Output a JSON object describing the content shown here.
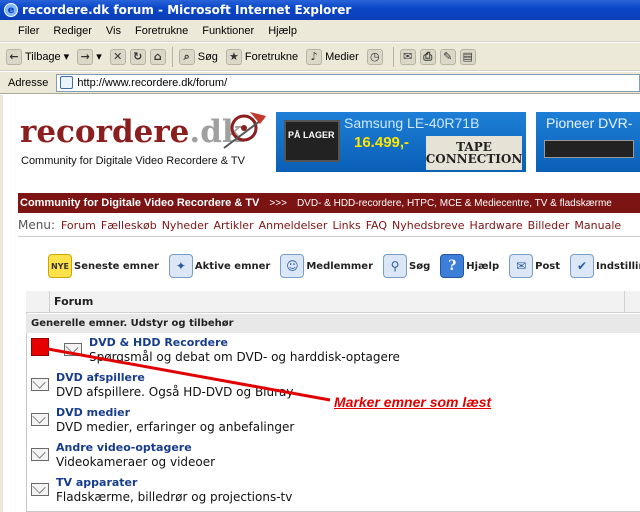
{
  "window": {
    "title": "recordere.dk forum - Microsoft Internet Explorer"
  },
  "menubar": {
    "items": [
      "Filer",
      "Rediger",
      "Vis",
      "Foretrukne",
      "Funktioner",
      "Hjælp"
    ]
  },
  "toolbar": {
    "back": "Tilbage",
    "search": "Søg",
    "favorites": "Foretrukne",
    "media": "Medier"
  },
  "addressbar": {
    "label": "Adresse",
    "url": "http://www.recordere.dk/forum/"
  },
  "site": {
    "logo_main": "recordere",
    "logo_tld": ".dk",
    "tagline": "Community for Digitale Video Recordere & TV",
    "banners": [
      {
        "badge": "PÅ LAGER",
        "title": "Samsung LE-40R71B",
        "price": "16.499,-",
        "brand": "TAPE CONNECTION"
      },
      {
        "title": "Pioneer DVR-"
      }
    ],
    "community_bar": {
      "left": "Community for Digitale Video Recordere & TV",
      "arrow": ">>>",
      "right": "DVD- & HDD-recordere, HTPC, MCE & Mediecentre, TV & fladskærme"
    },
    "site_menu": {
      "label": "Menu:",
      "items": [
        "Forum",
        "Fælleskøb",
        "Nyheder",
        "Artikler",
        "Anmeldelser",
        "Links",
        "FAQ",
        "Nyhedsbreve",
        "Hardware",
        "Billeder",
        "Manuale"
      ]
    },
    "nav_icons": [
      {
        "icon": "new-badge-icon",
        "badge": "NYE",
        "label": "Seneste emner"
      },
      {
        "icon": "sparkle-icon",
        "label": "Aktive emner"
      },
      {
        "icon": "members-icon",
        "label": "Medlemmer"
      },
      {
        "icon": "magnifier-icon",
        "label": "Søg"
      },
      {
        "icon": "help-icon",
        "label": "Hjælp"
      },
      {
        "icon": "mail-icon",
        "label": "Post"
      },
      {
        "icon": "settings-check-icon",
        "label": "Indstillinger"
      }
    ]
  },
  "forum": {
    "column_header": "Forum",
    "category": "Generelle emner. Udstyr og tilbehør",
    "rows": [
      {
        "name": "DVD & HDD Recordere",
        "desc": "Spørgsmål og debat om DVD- og harddisk-optagere"
      },
      {
        "name": "DVD afspillere",
        "desc": "DVD afspillere. Også HD-DVD og Bluray"
      },
      {
        "name": "DVD medier",
        "desc": "DVD medier, erfaringer og anbefalinger"
      },
      {
        "name": "Andre video-optagere",
        "desc": "Videokameraer og videoer"
      },
      {
        "name": "TV apparater",
        "desc": "Fladskærme, billedrør og projections-tv"
      }
    ]
  },
  "annotation": {
    "label": "Marker emner som læst",
    "color": "#e00000"
  }
}
